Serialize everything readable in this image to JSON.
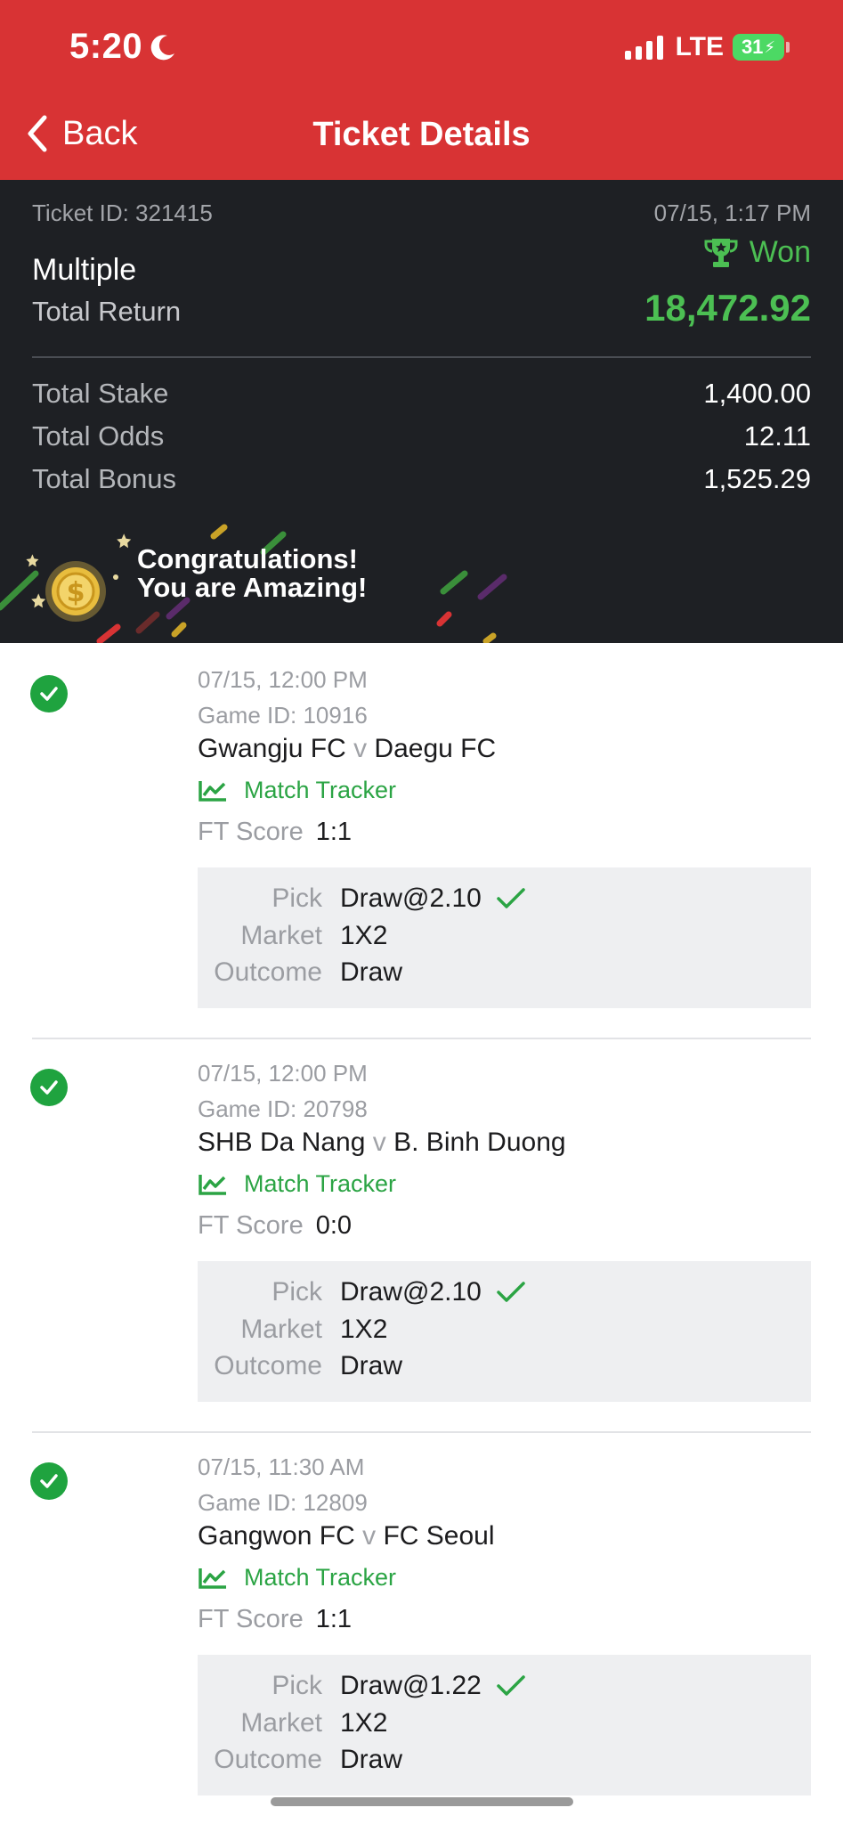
{
  "status_bar": {
    "time": "5:20",
    "network": "LTE",
    "battery": "31"
  },
  "header": {
    "back_label": "Back",
    "title": "Ticket Details"
  },
  "ticket": {
    "id_text": "Ticket ID: 321415",
    "date": "07/15, 1:17 PM",
    "status": "Won",
    "type": "Multiple",
    "total_return_label": "Total Return",
    "total_return": "18,472.92",
    "total_stake_label": "Total Stake",
    "total_stake": "1,400.00",
    "total_odds_label": "Total Odds",
    "total_odds": "12.11",
    "total_bonus_label": "Total Bonus",
    "total_bonus": "1,525.29"
  },
  "congrats": {
    "line1": "Congratulations!",
    "line2": "You are Amazing!"
  },
  "labels": {
    "match_tracker": "Match Tracker",
    "ft_score": "FT Score",
    "pick": "Pick",
    "market": "Market",
    "outcome": "Outcome",
    "versus": "v"
  },
  "bets": [
    {
      "date": "07/15, 12:00 PM",
      "game_id": "Game ID: 10916",
      "home": "Gwangju FC",
      "away": "Daegu FC",
      "score": "1:1",
      "pick": "Draw@2.10",
      "market": "1X2",
      "outcome": "Draw"
    },
    {
      "date": "07/15, 12:00 PM",
      "game_id": "Game ID: 20798",
      "home": "SHB Da Nang",
      "away": "B. Binh Duong",
      "score": "0:0",
      "pick": "Draw@2.10",
      "market": "1X2",
      "outcome": "Draw"
    },
    {
      "date": "07/15, 11:30 AM",
      "game_id": "Game ID: 12809",
      "home": "Gangwon FC",
      "away": "FC Seoul",
      "score": "1:1",
      "pick": "Draw@1.22",
      "market": "1X2",
      "outcome": "Draw"
    }
  ],
  "colors": {
    "header_red": "#d83334",
    "dark_panel": "#1e2024",
    "win_green": "#4cbf53",
    "check_green": "#1fa33f"
  }
}
